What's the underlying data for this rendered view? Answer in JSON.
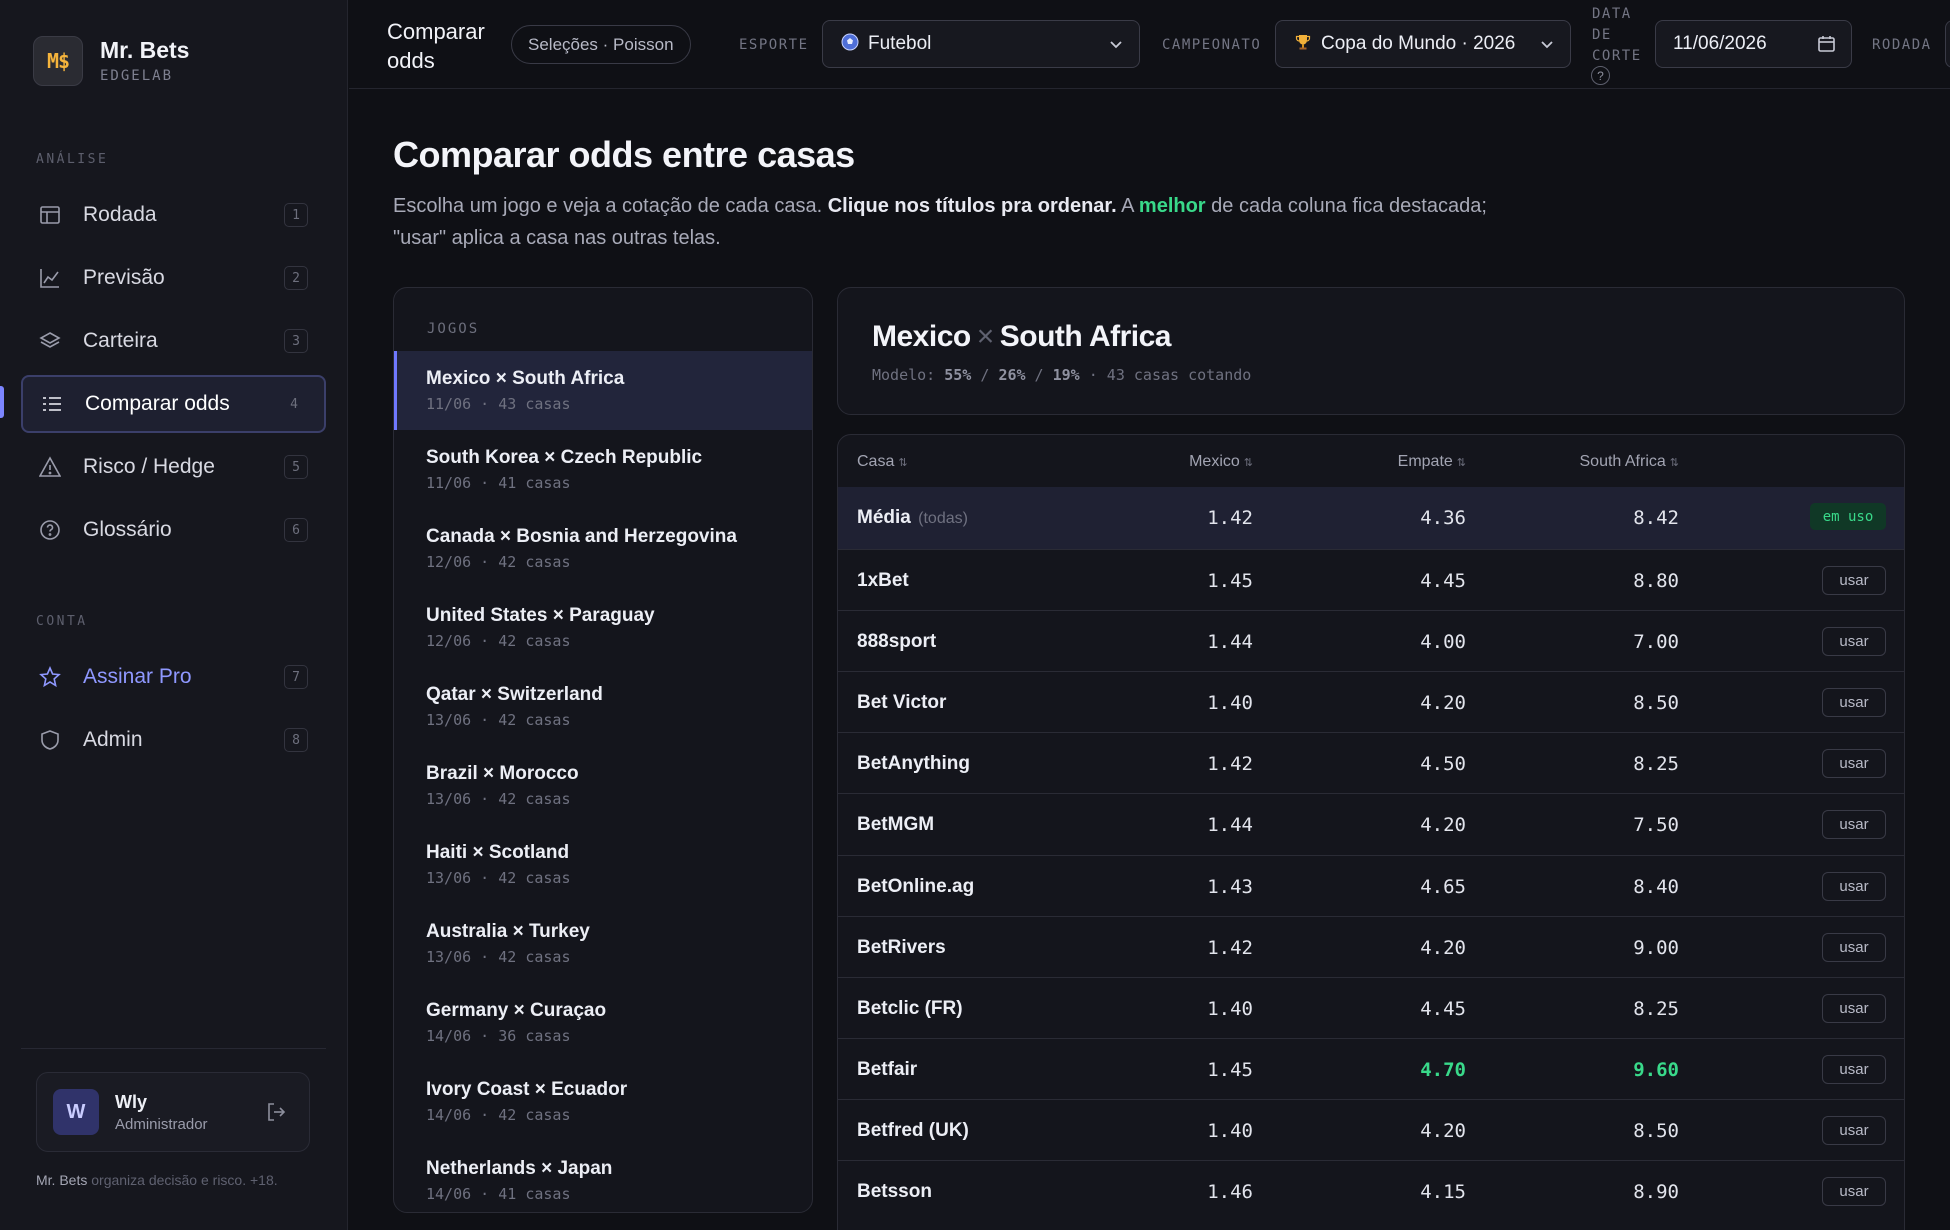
{
  "brand": {
    "logo": "M$",
    "name": "Mr. Bets",
    "sub": "EDGELAB"
  },
  "sidebar": {
    "section_analysis": "ANÁLISE",
    "section_account": "CONTA",
    "items": [
      {
        "label": "Rodada",
        "key": "1",
        "icon": "table-icon"
      },
      {
        "label": "Previsão",
        "key": "2",
        "icon": "chart-line-icon"
      },
      {
        "label": "Carteira",
        "key": "3",
        "icon": "layers-icon"
      },
      {
        "label": "Comparar odds",
        "key": "4",
        "icon": "list-icon"
      },
      {
        "label": "Risco / Hedge",
        "key": "5",
        "icon": "warning-icon"
      },
      {
        "label": "Glossário",
        "key": "6",
        "icon": "help-circle-icon"
      }
    ],
    "account_items": [
      {
        "label": "Assinar Pro",
        "key": "7",
        "icon": "star-icon"
      },
      {
        "label": "Admin",
        "key": "8",
        "icon": "shield-icon"
      }
    ],
    "user": {
      "initial": "W",
      "name": "Wly",
      "role": "Administrador"
    },
    "footnote_brand": "Mr. Bets",
    "footnote_text": " organiza decisão e risco. +18."
  },
  "topbar": {
    "title": "Comparar odds",
    "pill": "Seleções · Poisson",
    "sport_label": "ESPORTE",
    "sport_value": "Futebol",
    "league_label": "CAMPEONATO",
    "league_value": "Copa do Mundo · 2026",
    "cutoff_label_1": "DATA",
    "cutoff_label_2": "DE",
    "cutoff_label_3": "CORTE",
    "cutoff_help": "?",
    "cutoff_value": "11/06/2026",
    "round_label": "RODADA"
  },
  "page": {
    "title": "Comparar odds entre casas",
    "desc_1": "Escolha um jogo e veja a cotação de cada casa. ",
    "desc_bold": "Clique nos títulos pra ordenar.",
    "desc_2": " A ",
    "desc_hl": "melhor",
    "desc_3": " de cada coluna fica destacada; \"usar\" aplica a casa nas outras telas."
  },
  "games": {
    "label": "JOGOS",
    "items": [
      {
        "name": "Mexico × South Africa",
        "meta": "11/06 · 43 casas"
      },
      {
        "name": "South Korea × Czech Republic",
        "meta": "11/06 · 41 casas"
      },
      {
        "name": "Canada × Bosnia and Herzegovina",
        "meta": "12/06 · 42 casas"
      },
      {
        "name": "United States × Paraguay",
        "meta": "12/06 · 42 casas"
      },
      {
        "name": "Qatar × Switzerland",
        "meta": "13/06 · 42 casas"
      },
      {
        "name": "Brazil × Morocco",
        "meta": "13/06 · 42 casas"
      },
      {
        "name": "Haiti × Scotland",
        "meta": "13/06 · 42 casas"
      },
      {
        "name": "Australia × Turkey",
        "meta": "13/06 · 42 casas"
      },
      {
        "name": "Germany × Curaçao",
        "meta": "14/06 · 36 casas"
      },
      {
        "name": "Ivory Coast × Ecuador",
        "meta": "14/06 · 42 casas"
      },
      {
        "name": "Netherlands × Japan",
        "meta": "14/06 · 41 casas"
      }
    ]
  },
  "match": {
    "home": "Mexico",
    "sep": "×",
    "away": "South Africa",
    "model_label": "Modelo: ",
    "p_home": "55%",
    "p_draw": "26%",
    "p_away": "19%",
    "slash": " / ",
    "casas": " · 43 casas cotando"
  },
  "odds": {
    "headers": {
      "casa": "Casa",
      "home": "Mexico",
      "draw": "Empate",
      "away": "South Africa",
      "sort": "⇅"
    },
    "avg": {
      "name": "Média",
      "tag": "(todas)",
      "home": "1.42",
      "draw": "4.36",
      "away": "8.42",
      "badge": "em uso"
    },
    "use_label": "usar",
    "rows": [
      {
        "name": "1xBet",
        "home": "1.45",
        "draw": "4.45",
        "away": "8.80"
      },
      {
        "name": "888sport",
        "home": "1.44",
        "draw": "4.00",
        "away": "7.00"
      },
      {
        "name": "Bet Victor",
        "home": "1.40",
        "draw": "4.20",
        "away": "8.50"
      },
      {
        "name": "BetAnything",
        "home": "1.42",
        "draw": "4.50",
        "away": "8.25"
      },
      {
        "name": "BetMGM",
        "home": "1.44",
        "draw": "4.20",
        "away": "7.50"
      },
      {
        "name": "BetOnline.ag",
        "home": "1.43",
        "draw": "4.65",
        "away": "8.40"
      },
      {
        "name": "BetRivers",
        "home": "1.42",
        "draw": "4.20",
        "away": "9.00"
      },
      {
        "name": "Betclic (FR)",
        "home": "1.40",
        "draw": "4.45",
        "away": "8.25"
      },
      {
        "name": "Betfair",
        "home": "1.45",
        "draw": "4.70",
        "away": "9.60",
        "best": [
          "draw",
          "away"
        ]
      },
      {
        "name": "Betfred (UK)",
        "home": "1.40",
        "draw": "4.20",
        "away": "8.50"
      },
      {
        "name": "Betsson",
        "home": "1.46",
        "draw": "4.15",
        "away": "8.90"
      }
    ]
  },
  "colors": {
    "accent": "#7c85ff",
    "best": "#39d98a",
    "brand_gold": "#f5b43c"
  }
}
